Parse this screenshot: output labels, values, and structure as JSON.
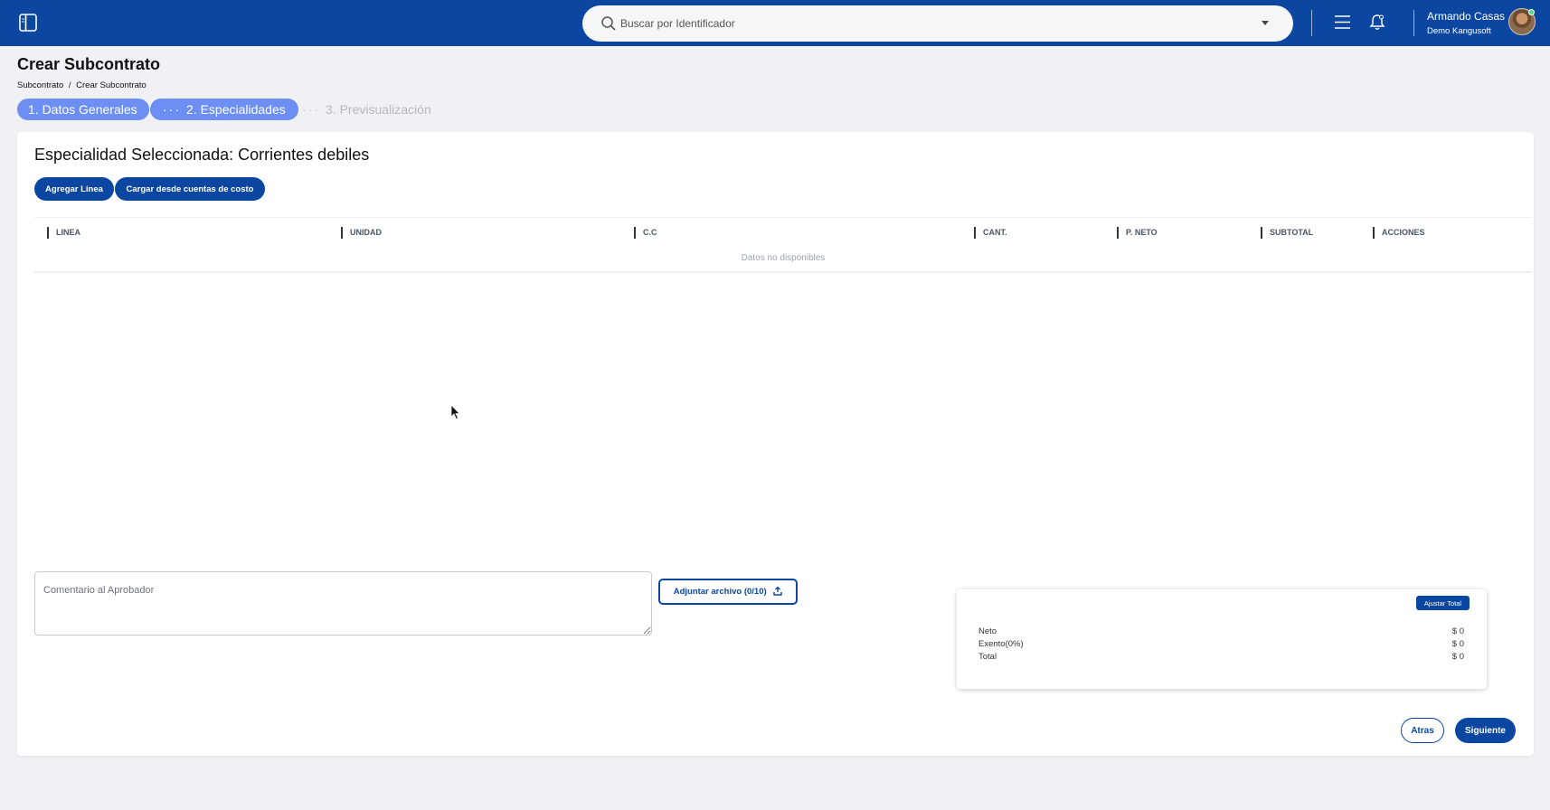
{
  "topbar": {
    "search_placeholder": "Buscar por Identificador",
    "user_name": "Armando Casas",
    "user_company": "Demo Kangusoft"
  },
  "page": {
    "title": "Crear Subcontrato",
    "breadcrumb": [
      "Subcontrato",
      "Crear Subcontrato"
    ],
    "breadcrumb_separator": "/"
  },
  "steps": [
    {
      "label": "1. Datos Generales",
      "state": "done"
    },
    {
      "label": "2. Especialidades",
      "state": "active"
    },
    {
      "label": "3. Previsualización",
      "state": "pending"
    }
  ],
  "section": {
    "title": "Especialidad Seleccionada: Corrientes debiles",
    "add_line_label": "Agregar Línea",
    "load_costs_label": "Cargar desde cuentas de costo"
  },
  "table": {
    "headers": [
      "LINEA",
      "UNIDAD",
      "C.C",
      "CANT.",
      "P. NETO",
      "SUBTOTAL",
      "ACCIONES"
    ],
    "empty_text": "Datos no disponibles"
  },
  "comment": {
    "placeholder": "Comentario al Aprobador",
    "value": ""
  },
  "attach_label": "Adjuntar archivo (0/10)",
  "totals": {
    "adjust_label": "Ajustar Total",
    "rows": [
      {
        "label": "Neto",
        "value": "$ 0"
      },
      {
        "label": "Exento(0%)",
        "value": "$ 0"
      },
      {
        "label": "Total",
        "value": "$ 0"
      }
    ]
  },
  "footer": {
    "back_label": "Atras",
    "next_label": "Siguiente"
  },
  "colors": {
    "primary": "#0b47a1",
    "step_active": "#6d8ff4",
    "background": "#eff1f5"
  }
}
